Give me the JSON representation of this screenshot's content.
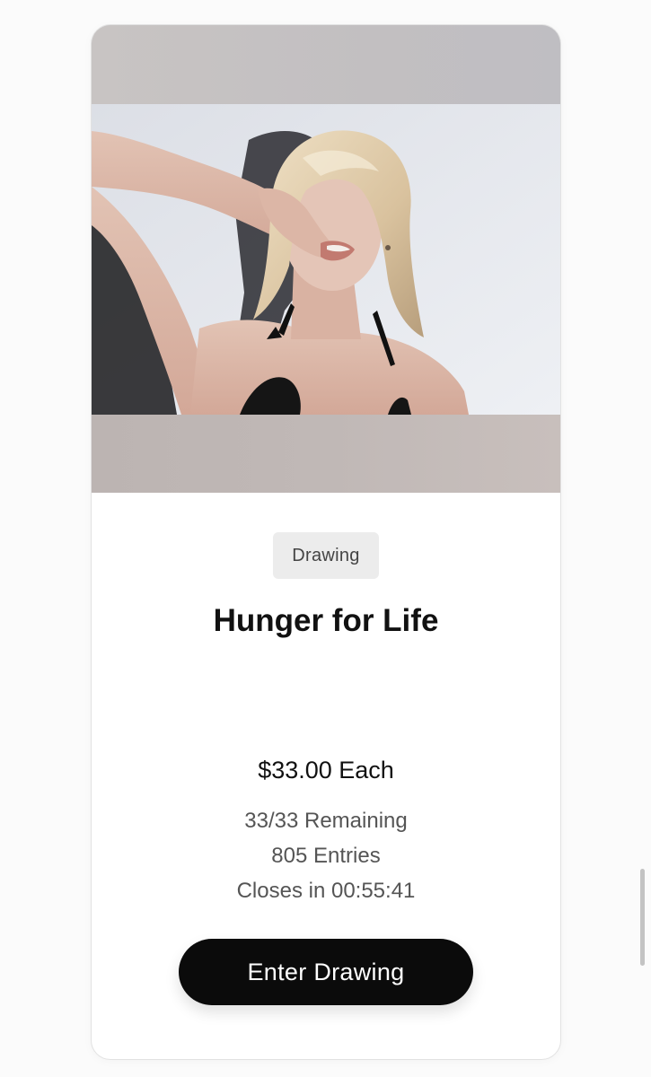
{
  "card": {
    "badge": "Drawing",
    "title": "Hunger for Life",
    "price": "$33.00 Each",
    "remaining": "33/33 Remaining",
    "entries": "805 Entries",
    "closes": "Closes in 00:55:41",
    "cta_label": "Enter Drawing"
  },
  "colors": {
    "cta_background": "#0b0b0b",
    "badge_background": "#ececec",
    "text_primary": "#111111",
    "text_secondary": "#555555"
  }
}
